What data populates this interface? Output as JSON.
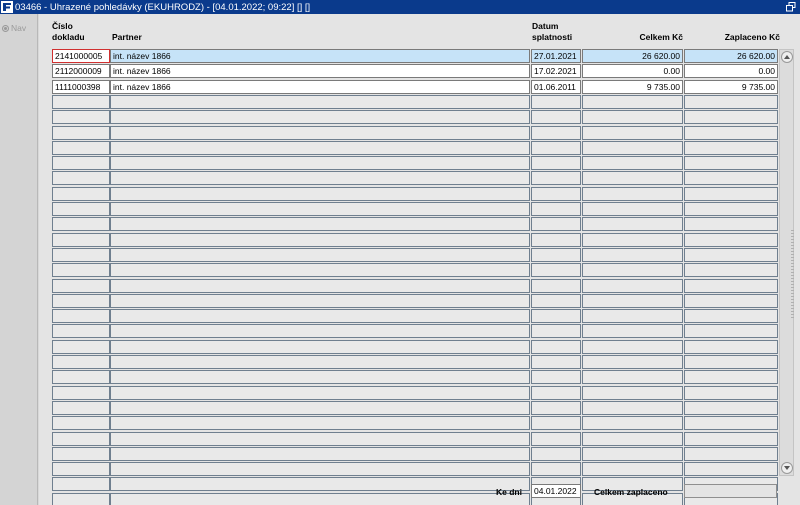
{
  "window": {
    "title": "03466 - Uhrazené pohledávky (EKUHRODZ) - [04.01.2022; 09:22] [] []",
    "app_icon": "oracle-forms-icon",
    "restore_icon": "restore-window-icon"
  },
  "nav": {
    "label": "Nav"
  },
  "columns": {
    "doc_no_line1": "Číslo",
    "doc_no_line2": "dokladu",
    "partner": "Partner",
    "due_line1": "Datum",
    "due_line2": "splatnosti",
    "total": "Celkem Kč",
    "paid": "Zaplaceno Kč"
  },
  "rows": [
    {
      "doc_no": "2141000005",
      "partner": "int. název 1866",
      "due_date": "27.01.2021",
      "total": "26 620.00",
      "paid": "26 620.00"
    },
    {
      "doc_no": "2112000009",
      "partner": "int. název 1866",
      "due_date": "17.02.2021",
      "total": "0.00",
      "paid": "0.00"
    },
    {
      "doc_no": "1111000398",
      "partner": "int. název 1866",
      "due_date": "01.06.2011",
      "total": "9 735.00",
      "paid": "9 735.00"
    }
  ],
  "empty_rows": 27,
  "selected_row": 0,
  "footer": {
    "ke_dni_label": "Ke dni",
    "ke_dni_value": "04.01.2022",
    "celkem_zaplaceno_label": "Celkem zaplaceno",
    "celkem_zaplaceno_value": ""
  },
  "colors": {
    "titlebar": "#0a3a8c",
    "selected_row": "#c6e3f8",
    "current_cell_border": "#d03030"
  }
}
